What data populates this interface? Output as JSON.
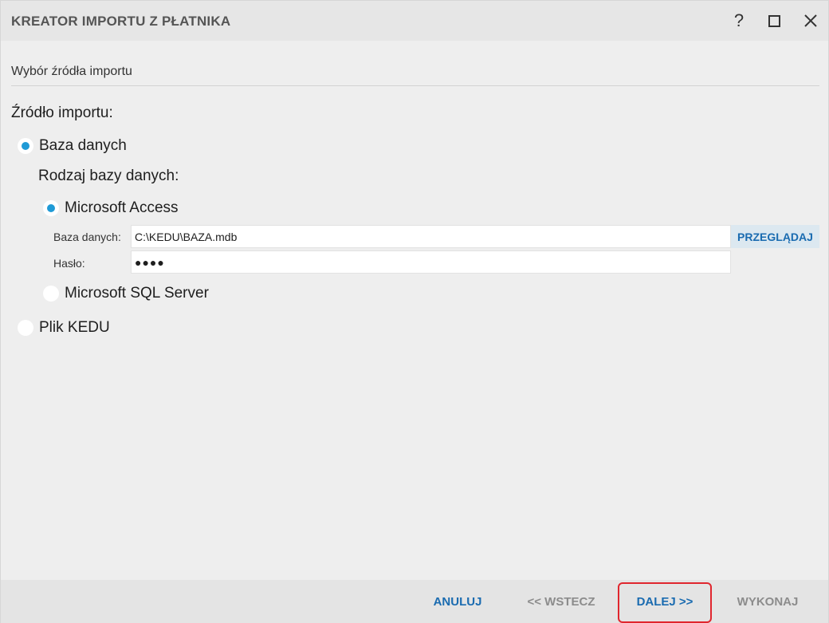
{
  "window": {
    "title": "KREATOR IMPORTU Z PŁATNIKA",
    "help_glyph": "?",
    "maximize_icon": "maximize-icon",
    "close_icon": "close-icon"
  },
  "step": {
    "title": "Wybór źródła importu"
  },
  "source": {
    "label": "Źródło importu:",
    "database_option": "Baza danych",
    "database_selected": true,
    "db_type_label": "Rodzaj bazy danych:",
    "access_option": "Microsoft Access",
    "access_selected": true,
    "db_path_label": "Baza danych:",
    "db_path_value": "C:\\KEDU\\BAZA.mdb",
    "browse_label": "PRZEGLĄDAJ",
    "password_label": "Hasło:",
    "password_value": "●●●●",
    "sql_option": "Microsoft SQL Server",
    "sql_selected": false,
    "kedu_option": "Plik KEDU",
    "kedu_selected": false
  },
  "footer": {
    "cancel_label": "ANULUJ",
    "back_label": "<< WSTECZ",
    "next_label": "DALEJ >>",
    "finish_label": "WYKONAJ"
  },
  "colors": {
    "accent_blue": "#1a6bb0",
    "radio_dot": "#1f9ad6",
    "highlight_red": "#e0262e",
    "disabled_gray": "#8c8c8c"
  }
}
